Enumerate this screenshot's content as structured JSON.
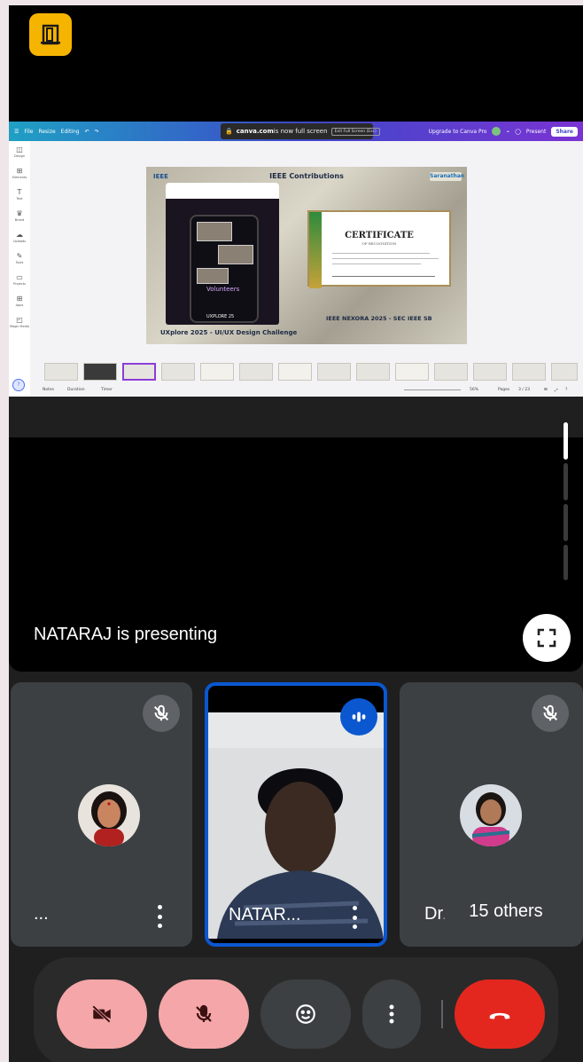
{
  "canva": {
    "toolbar_left": [
      "File",
      "Resize",
      "Editing"
    ],
    "fullscreen_domain": "canva.com",
    "fullscreen_text": " is now full screen",
    "fullscreen_exit": "Exit Full Screen (Esc)",
    "toolbar_right": [
      "Upgrade to Canva Pro",
      "Present",
      "Share"
    ],
    "sidebar": [
      "Design",
      "Elements",
      "Text",
      "Brand",
      "Uploads",
      "Tools",
      "Projects",
      "Apps",
      "Magic Media"
    ],
    "bottom": {
      "notes": "Notes",
      "duration": "Duration",
      "timer": "Timer",
      "zoom": "56%",
      "pages": "Pages",
      "page_count": "3 / 23"
    }
  },
  "slide": {
    "brand_left": "IEEE",
    "title": "IEEE Contributions",
    "brand_right": "Saranathan",
    "poster_label": "Volunteers",
    "poster_event": "UXPLORE 25",
    "caption_left": "UXplore 2025 - UI/UX Design Challenge",
    "certificate_title": "CERTIFICATE",
    "certificate_sub": "OF RECOGNITION",
    "caption_right": "IEEE NEXORA 2025 - SEC IEEE SB"
  },
  "meet": {
    "presenting_label": "NATARAJ is presenting",
    "participants": [
      {
        "name": "...",
        "muted": true
      },
      {
        "name": "NATAR...",
        "speaking": true
      },
      {
        "name": "Dr.S",
        "muted": true
      }
    ],
    "others_label": "15 others"
  },
  "colors": {
    "accent_blue": "#0b57d0",
    "end_call_red": "#e3271f",
    "off_pink": "#f5a6a8",
    "exit_yellow": "#f5b400"
  },
  "icons": {
    "exit": "door-exit-icon",
    "fullscreen": "fullscreen-icon",
    "muted": "mic-off-icon",
    "speaking": "audio-wave-icon",
    "camera_off": "camera-off-icon",
    "mic_off": "mic-off-icon",
    "reactions": "emoji-icon",
    "more": "more-vertical-icon",
    "end_call": "hang-up-icon"
  }
}
